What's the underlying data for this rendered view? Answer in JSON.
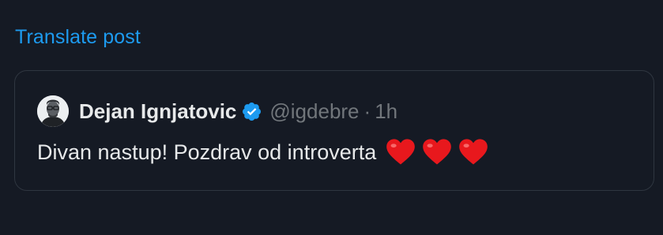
{
  "translate": {
    "label": "Translate post"
  },
  "quote": {
    "author_name": "Dejan Ignjatovic",
    "handle": "@igdebre",
    "separator": "·",
    "timestamp": "1h",
    "text": "Divan nastup! Pozdrav od introverta",
    "verified": true,
    "verified_color": "#1d9bf0",
    "emoji_count": 3,
    "emoji_icon": "red-heart-icon",
    "emoji_color": "#e8181d"
  },
  "colors": {
    "background": "#151a24",
    "link": "#1d9bf0",
    "muted_text": "#71767b",
    "primary_text": "#e7e9ea",
    "card_border": "#2f3640"
  }
}
